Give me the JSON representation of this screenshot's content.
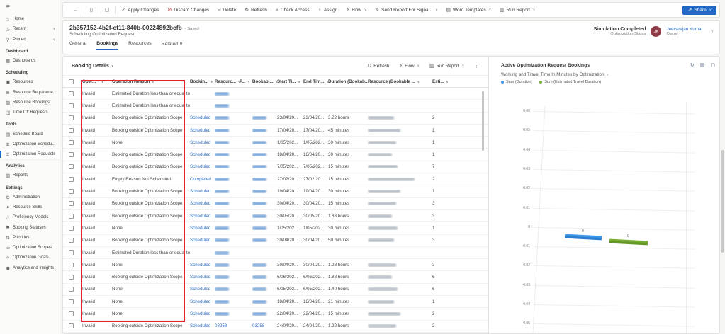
{
  "colors": {
    "accent_blue": "#2266c8",
    "link_blue": "#2b6cbf",
    "share_button": "#2068c3",
    "avatar_maroon": "#8f3a47",
    "annotation_red": "#e8232a",
    "discard_red": "#d13438"
  },
  "command_bar": {
    "back_icon": "back-arrow",
    "items": [
      {
        "label": "Apply Changes",
        "icon": "check"
      },
      {
        "label": "Discard Changes",
        "icon": "discard"
      },
      {
        "label": "Delete",
        "icon": "trash"
      },
      {
        "label": "Refresh",
        "icon": "refresh"
      },
      {
        "label": "Check Access",
        "icon": "magnifier-key"
      },
      {
        "label": "Assign",
        "icon": "person"
      },
      {
        "label": "Flow",
        "icon": "flow",
        "chevron": true
      },
      {
        "label": "Send Report For Signa...",
        "icon": "signature",
        "chevron": true
      },
      {
        "label": "Word Templates",
        "icon": "word-doc",
        "chevron": true
      },
      {
        "label": "Run Report",
        "icon": "report",
        "chevron": true
      }
    ],
    "share_label": "Share"
  },
  "record": {
    "title": "2b357152-4b2f-ef11-840b-00224892bcfb",
    "saved_status": "- Saved",
    "entity": "Scheduling Optimization Request",
    "tabs": [
      {
        "label": "General"
      },
      {
        "label": "Bookings",
        "active": true
      },
      {
        "label": "Resources"
      },
      {
        "label": "Related",
        "chevron": true
      }
    ],
    "status_value": "Simulation Completed",
    "status_label": "Optimization Status",
    "owner_initials": "JK",
    "owner_name": "Jeevarajan Kumar",
    "owner_role": "Owner"
  },
  "sidebar": {
    "sections": [
      {
        "label": "",
        "items": [
          {
            "label": "Home",
            "icon": "home"
          },
          {
            "label": "Recent",
            "icon": "clock",
            "chevron": true
          },
          {
            "label": "Pinned",
            "icon": "pin",
            "chevron": true
          }
        ]
      },
      {
        "label": "Dashboard",
        "items": [
          {
            "label": "Dashboards",
            "icon": "dashboard"
          }
        ]
      },
      {
        "label": "Scheduling",
        "items": [
          {
            "label": "Resources",
            "icon": "resources"
          },
          {
            "label": "Resource Requireme...",
            "icon": "requirements"
          },
          {
            "label": "Resource Bookings",
            "icon": "bookings"
          },
          {
            "label": "Time Off Requests",
            "icon": "time-off"
          }
        ]
      },
      {
        "label": "Tools",
        "items": [
          {
            "label": "Schedule Board",
            "icon": "schedule-board"
          },
          {
            "label": "Optimization Schedu...",
            "icon": "optimization-schedules"
          },
          {
            "label": "Optimization Requests",
            "icon": "optimization-requests",
            "selected": true
          }
        ]
      },
      {
        "label": "Analytics",
        "items": [
          {
            "label": "Reports",
            "icon": "reports"
          }
        ]
      },
      {
        "label": "Settings",
        "items": [
          {
            "label": "Administration",
            "icon": "gear"
          },
          {
            "label": "Resource Skills",
            "icon": "skills"
          },
          {
            "label": "Proficiency Models",
            "icon": "star"
          },
          {
            "label": "Booking Statuses",
            "icon": "flag"
          },
          {
            "label": "Priorities",
            "icon": "priorities"
          },
          {
            "label": "Optimization Scopes",
            "icon": "scopes"
          },
          {
            "label": "Optimization Goals",
            "icon": "goals"
          },
          {
            "label": "Analytics and Insights",
            "icon": "insights"
          }
        ]
      }
    ]
  },
  "table": {
    "title": "Booking Details",
    "toolbar": [
      {
        "label": "Refresh",
        "icon": "refresh"
      },
      {
        "label": "Flow",
        "icon": "flow",
        "chevron": true
      },
      {
        "label": "Run Report",
        "icon": "report",
        "chevron": true
      },
      {
        "label": "",
        "icon": "more"
      }
    ],
    "columns": [
      {
        "label": "Oper...",
        "sort": "asc"
      },
      {
        "label": "Operation Reason"
      },
      {
        "label": "Bookin..."
      },
      {
        "label": "Resourc..."
      },
      {
        "label": "P..."
      },
      {
        "label": "Bookabl..."
      },
      {
        "label": "Start Ti..."
      },
      {
        "label": "End Tim..."
      },
      {
        "label": "Duration (Bookab..."
      },
      {
        "label": "Resource (Bookable ..."
      },
      {
        "label": "Esti..."
      }
    ],
    "rows": [
      {
        "operation": "Invalid",
        "reason": "Estimated Duration less than or equal to 0",
        "status": "",
        "resourc": "",
        "resourc_redacted": true,
        "bookabl": "",
        "bookabl_redacted": false,
        "start": "",
        "end": "",
        "duration": "",
        "resource_redacted": false,
        "estimated": ""
      },
      {
        "operation": "Invalid",
        "reason": "Estimated Duration less than or equal to 0",
        "status": "",
        "resourc": "",
        "resourc_redacted": true,
        "bookabl": "",
        "bookabl_redacted": false,
        "start": "",
        "end": "",
        "duration": "",
        "resource_redacted": false,
        "estimated": ""
      },
      {
        "operation": "Invalid",
        "reason": "Booking outside Optimization Scope",
        "status": "Scheduled",
        "resourc": "",
        "resourc_redacted": true,
        "bookabl": "",
        "bookabl_redacted": true,
        "start": "23/04/20...",
        "end": "23/04/20...",
        "duration": "3.22 hours",
        "resource_redacted": true,
        "estimated": "2"
      },
      {
        "operation": "Invalid",
        "reason": "Booking outside Optimization Scope",
        "status": "Scheduled",
        "resourc": "",
        "resourc_redacted": true,
        "bookabl": "",
        "bookabl_redacted": true,
        "start": "17/04/20...",
        "end": "17/04/20...",
        "duration": "45 minutes",
        "resource_redacted": true,
        "estimated": "1"
      },
      {
        "operation": "Invalid",
        "reason": "None",
        "status": "Scheduled",
        "resourc": "",
        "resourc_redacted": true,
        "bookabl": "",
        "bookabl_redacted": true,
        "start": "1/05/202...",
        "end": "1/05/202...",
        "duration": "30 minutes",
        "resource_redacted": true,
        "estimated": "1"
      },
      {
        "operation": "Invalid",
        "reason": "Booking outside Optimization Scope",
        "status": "Scheduled",
        "resourc": "",
        "resourc_redacted": true,
        "bookabl": "",
        "bookabl_redacted": true,
        "start": "18/04/20...",
        "end": "18/04/20...",
        "duration": "30 minutes",
        "resource_redacted": true,
        "estimated": "1"
      },
      {
        "operation": "Invalid",
        "reason": "Booking outside Optimization Scope",
        "status": "Scheduled",
        "resourc": "",
        "resourc_redacted": true,
        "bookabl": "",
        "bookabl_redacted": true,
        "start": "7/05/202...",
        "end": "7/05/202...",
        "duration": "15 minutes",
        "resource_redacted": true,
        "estimated": "7"
      },
      {
        "operation": "Invalid",
        "reason": "Empty Reason Not Scheduled",
        "status": "Completed",
        "resourc": "",
        "resourc_redacted": true,
        "bookabl": "",
        "bookabl_redacted": true,
        "start": "27/02/20...",
        "end": "27/02/20...",
        "duration": "15 minutes",
        "resource_redacted": true,
        "wide_name": true,
        "estimated": "2"
      },
      {
        "operation": "Invalid",
        "reason": "Booking outside Optimization Scope",
        "status": "Scheduled",
        "resourc": "",
        "resourc_redacted": true,
        "bookabl": "",
        "bookabl_redacted": true,
        "start": "19/04/20...",
        "end": "19/04/20...",
        "duration": "30 minutes",
        "resource_redacted": true,
        "estimated": "1"
      },
      {
        "operation": "Invalid",
        "reason": "Booking outside Optimization Scope",
        "status": "Scheduled",
        "resourc": "",
        "resourc_redacted": true,
        "bookabl": "",
        "bookabl_redacted": true,
        "start": "30/04/20...",
        "end": "30/04/20...",
        "duration": "15 minutes",
        "resource_redacted": true,
        "estimated": "3"
      },
      {
        "operation": "Invalid",
        "reason": "Booking outside Optimization Scope",
        "status": "Scheduled",
        "resourc": "",
        "resourc_redacted": true,
        "bookabl": "",
        "bookabl_redacted": true,
        "start": "30/05/20...",
        "end": "30/05/20...",
        "duration": "1.88 hours",
        "resource_redacted": true,
        "estimated": "3"
      },
      {
        "operation": "Invalid",
        "reason": "None",
        "status": "Scheduled",
        "resourc": "",
        "resourc_redacted": true,
        "bookabl": "",
        "bookabl_redacted": true,
        "start": "1/05/202...",
        "end": "1/05/202...",
        "duration": "30 minutes",
        "resource_redacted": true,
        "estimated": "1"
      },
      {
        "operation": "Invalid",
        "reason": "Booking outside Optimization Scope",
        "status": "Scheduled",
        "resourc": "",
        "resourc_redacted": true,
        "bookabl": "",
        "bookabl_redacted": true,
        "start": "30/04/20...",
        "end": "30/04/20...",
        "duration": "50 minutes",
        "resource_redacted": true,
        "estimated": "3"
      },
      {
        "operation": "Invalid",
        "reason": "Estimated Duration less than or equal to 0",
        "status": "",
        "resourc": "",
        "resourc_redacted": true,
        "bookabl": "",
        "bookabl_redacted": false,
        "start": "",
        "end": "",
        "duration": "",
        "resource_redacted": false,
        "estimated": ""
      },
      {
        "operation": "Invalid",
        "reason": "None",
        "status": "Scheduled",
        "resourc": "",
        "resourc_redacted": true,
        "bookabl": "",
        "bookabl_redacted": true,
        "start": "30/04/20...",
        "end": "30/04/20...",
        "duration": "1.28 hours",
        "resource_redacted": true,
        "estimated": "3"
      },
      {
        "operation": "Invalid",
        "reason": "Booking outside Optimization Scope",
        "status": "Scheduled",
        "resourc": "",
        "resourc_redacted": true,
        "bookabl": "",
        "bookabl_redacted": true,
        "start": "6/06/202...",
        "end": "6/06/202...",
        "duration": "1.88 hours",
        "resource_redacted": true,
        "estimated": "6"
      },
      {
        "operation": "Invalid",
        "reason": "None",
        "status": "Scheduled",
        "resourc": "",
        "resourc_redacted": true,
        "bookabl": "",
        "bookabl_redacted": true,
        "start": "6/05/202...",
        "end": "6/05/202...",
        "duration": "1.40 hours",
        "resource_redacted": true,
        "estimated": "6"
      },
      {
        "operation": "Invalid",
        "reason": "None",
        "status": "Scheduled",
        "resourc": "",
        "resourc_redacted": true,
        "bookabl": "",
        "bookabl_redacted": true,
        "start": "18/04/20...",
        "end": "18/04/20...",
        "duration": "21 minutes",
        "resource_redacted": true,
        "estimated": "1"
      },
      {
        "operation": "Invalid",
        "reason": "None",
        "status": "Scheduled",
        "resourc": "",
        "resourc_redacted": true,
        "bookabl": "",
        "bookabl_redacted": true,
        "start": "22/04/20...",
        "end": "22/04/20...",
        "duration": "15 minutes",
        "resource_redacted": true,
        "estimated": "2"
      },
      {
        "operation": "Invalid",
        "reason": "Booking outside Optimization Scope",
        "status": "Scheduled",
        "resourc": "03258",
        "resourc_redacted": false,
        "bookabl": "03258",
        "bookabl_redacted": false,
        "start": "24/04/20...",
        "end": "24/04/20...",
        "duration": "1.22 hours",
        "resource_redacted": true,
        "estimated": "2"
      }
    ]
  },
  "chart_data": {
    "type": "bar",
    "projection": "3d",
    "title": "Active Optimization Request Bookings",
    "view_selector": "Working and Travel Time In Minutes by Optimization",
    "categories": [
      ""
    ],
    "series": [
      {
        "name": "Sum (Duration)",
        "color": "#3d96e8",
        "color_dark": "#2b7fd2",
        "values": [
          0
        ],
        "data_labels": [
          "0"
        ]
      },
      {
        "name": "Sum (Estimated Travel Duration)",
        "color": "#78ac35",
        "color_dark": "#649723",
        "values": [
          0
        ],
        "data_labels": [
          "0"
        ]
      }
    ],
    "ylim": [
      -0.05,
      0.06
    ],
    "yticks": [
      0.06,
      0.05,
      0.04,
      0.03,
      0.02,
      0.01,
      0,
      -0.01,
      -0.02,
      -0.03,
      -0.04,
      -0.05
    ],
    "grid": true,
    "legend_position": "top"
  }
}
